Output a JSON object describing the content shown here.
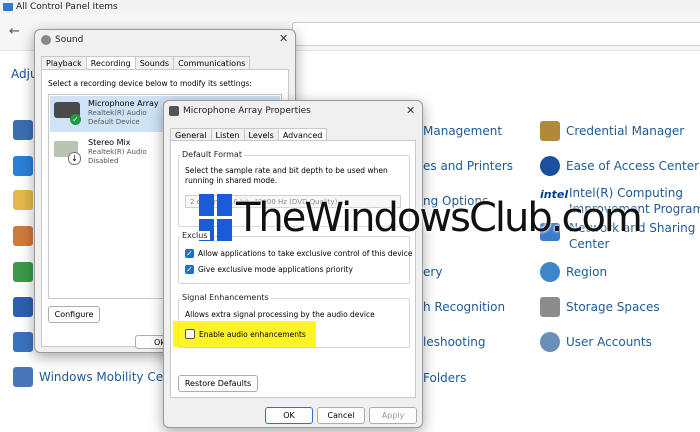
{
  "control_panel": {
    "title": "All Control Panel Items",
    "adjust_heading": "Adju",
    "left_item_label": "Windows Mobility Cente",
    "middle_items": [
      {
        "label": "Management",
        "icon": "admin-tools-icon"
      },
      {
        "label": "es and Printers",
        "icon": "printer-icon"
      },
      {
        "label": "ng Options",
        "icon": "indexing-icon"
      },
      {
        "label": "ery",
        "icon": "recovery-icon"
      },
      {
        "label": "h Recognition",
        "icon": "speech-icon"
      },
      {
        "label": "leshooting",
        "icon": "troubleshoot-icon"
      },
      {
        "label": "Folders",
        "icon": "folder-icon"
      }
    ],
    "right_items": [
      {
        "label": "Credential Manager",
        "icon": "credential-icon"
      },
      {
        "label": "Ease of Access Center",
        "icon": "ease-of-access-icon"
      },
      {
        "label": "Intel(R) Computing",
        "icon": "intel-icon"
      },
      {
        "label": "Improvement Program",
        "icon": ""
      },
      {
        "label": "Network and Sharing",
        "icon": "network-icon"
      },
      {
        "label": "Center",
        "icon": ""
      },
      {
        "label": "Region",
        "icon": "region-icon"
      },
      {
        "label": "Storage Spaces",
        "icon": "storage-icon"
      },
      {
        "label": "User Accounts",
        "icon": "users-icon"
      }
    ]
  },
  "sound_dialog": {
    "title": "Sound",
    "tabs": [
      "Playback",
      "Recording",
      "Sounds",
      "Communications"
    ],
    "active_tab": "Recording",
    "instruction": "Select a recording device below to modify its settings:",
    "devices": [
      {
        "name": "Microphone Array",
        "driver": "Realtek(R) Audio",
        "status": "Default Device"
      },
      {
        "name": "Stereo Mix",
        "driver": "Realtek(R) Audio",
        "status": "Disabled"
      }
    ],
    "configure_label": "Configure",
    "ok_fragment": "Ok"
  },
  "properties_dialog": {
    "title": "Microphone Array Properties",
    "tabs": [
      "General",
      "Listen",
      "Levels",
      "Advanced"
    ],
    "active_tab": "Advanced",
    "default_format": {
      "title": "Default Format",
      "description": "Select the sample rate and bit depth to be used when running in shared mode.",
      "selected": "2 channel, 16 bit, 48000 Hz (DVD Quality)"
    },
    "exclusive": {
      "title": "Exclusive Mode",
      "title_visible": "Exclus",
      "allow_label": "Allow applications to take exclusive control of this device",
      "allow_checked": true,
      "priority_label": "Give exclusive mode applications priority",
      "priority_checked": true
    },
    "signal": {
      "title": "Signal Enhancements",
      "description": "Allows extra signal processing by the audio device",
      "enable_label": "Enable audio enhancements",
      "enable_checked": false,
      "highlight_color": "#fff200"
    },
    "restore_label": "Restore Defaults",
    "ok_label": "OK",
    "cancel_label": "Cancel",
    "apply_label": "Apply"
  },
  "watermark": {
    "text": "TheWindowsClub.com",
    "color": "#1a5bd8"
  }
}
